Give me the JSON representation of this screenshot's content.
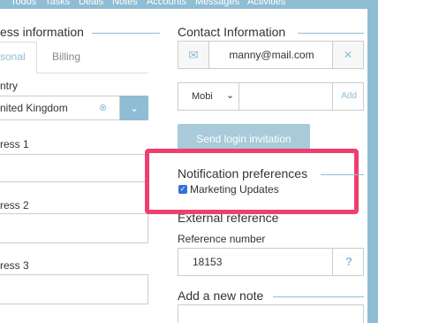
{
  "topnav": {
    "items": [
      "Todos",
      "Tasks",
      "Deals",
      "Notes",
      "Accounts",
      "Messages",
      "Activities"
    ]
  },
  "business": {
    "heading": "ess information",
    "tabs": [
      "sonal",
      "Billing"
    ],
    "country_label": "ntry",
    "country_value": "nited Kingdom",
    "address1_label": "ress 1",
    "address2_label": "ress 2",
    "address3_label": "ress 3"
  },
  "contact": {
    "heading": "Contact Information",
    "email_value": "manny@mail.com",
    "phone_type": "Mobi",
    "phone_add": "Add",
    "send_login": "Send login invitation"
  },
  "notifications": {
    "heading": "Notification preferences",
    "marketing_label": "Marketing Updates",
    "marketing_checked": true
  },
  "external": {
    "heading": "External reference",
    "reference_label": "Reference number",
    "reference_value": "18153",
    "help_symbol": "?"
  },
  "note": {
    "heading": "Add a new note"
  },
  "colors": {
    "accent": "#8fbdd3",
    "highlight": "#ef3f6d",
    "checkbox": "#2f72d8"
  }
}
